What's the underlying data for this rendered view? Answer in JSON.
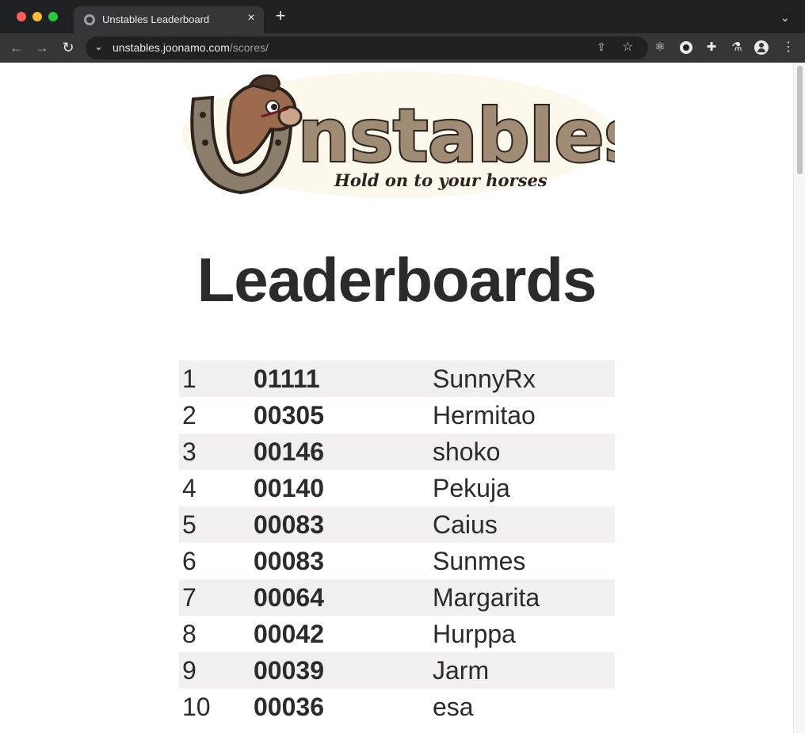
{
  "browser": {
    "tab_title": "Unstables Leaderboard",
    "tab_close": "×",
    "new_tab": "+",
    "url_host": "unstables.joonamo.com",
    "url_path": "/scores/"
  },
  "logo": {
    "wordmark": "nstables",
    "tagline": "Hold on to your horses"
  },
  "page": {
    "title": "Leaderboards"
  },
  "leaderboard": [
    {
      "rank": "1",
      "score": "01111",
      "name": "SunnyRx"
    },
    {
      "rank": "2",
      "score": "00305",
      "name": "Hermitao"
    },
    {
      "rank": "3",
      "score": "00146",
      "name": "shoko"
    },
    {
      "rank": "4",
      "score": "00140",
      "name": "Pekuja"
    },
    {
      "rank": "5",
      "score": "00083",
      "name": "Caius"
    },
    {
      "rank": "6",
      "score": "00083",
      "name": "Sunmes"
    },
    {
      "rank": "7",
      "score": "00064",
      "name": "Margarita"
    },
    {
      "rank": "8",
      "score": "00042",
      "name": "Hurppa"
    },
    {
      "rank": "9",
      "score": "00039",
      "name": "Jarm"
    },
    {
      "rank": "10",
      "score": "00036",
      "name": "esa"
    }
  ],
  "colors": {
    "row_stripe": "#f2efee",
    "text": "#2b2b2b",
    "chrome_dark": "#202124",
    "chrome_mid": "#35363a"
  }
}
